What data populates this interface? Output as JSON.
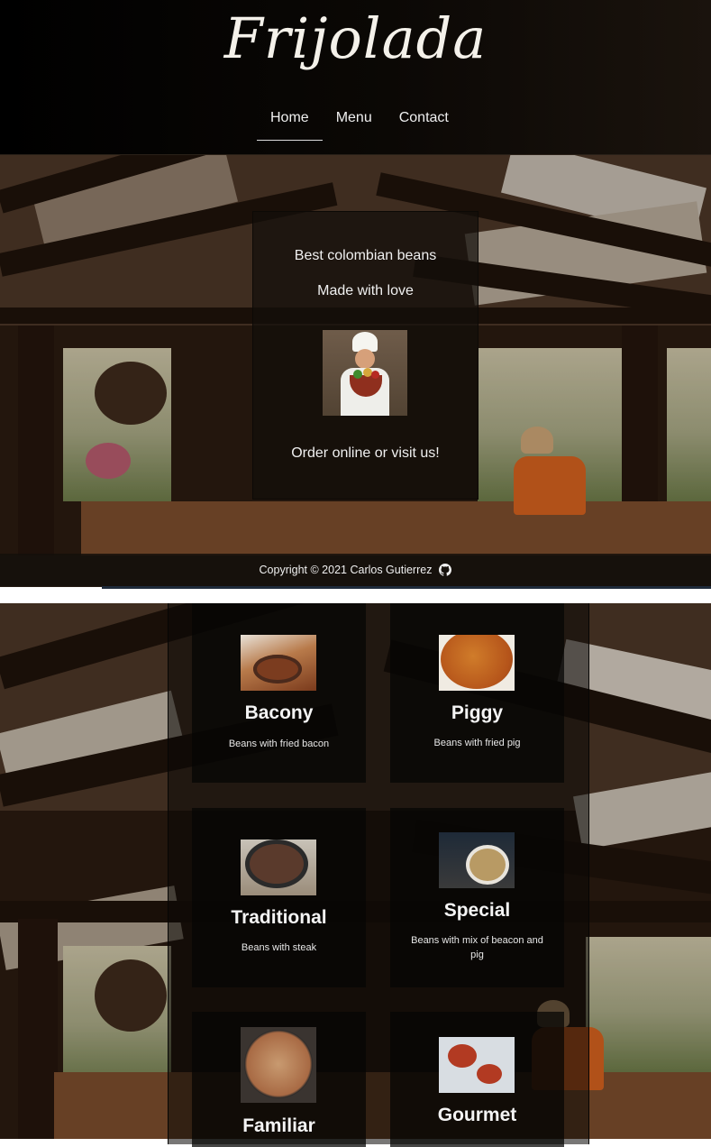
{
  "header": {
    "brand": "Frijolada",
    "nav": [
      {
        "label": "Home",
        "active": true
      },
      {
        "label": "Menu",
        "active": false
      },
      {
        "label": "Contact",
        "active": false
      }
    ]
  },
  "hero": {
    "line1": "Best colombian beans",
    "line2": "Made with love",
    "line3": "Order online or visit us!",
    "image_icon": "chef-icon"
  },
  "footer": {
    "copyright": "Copyright © 2021 Carlos Gutierrez",
    "icon": "github-icon"
  },
  "menu": {
    "items": [
      {
        "title": "Bacony",
        "desc": "Beans with fried bacon"
      },
      {
        "title": "Piggy",
        "desc": "Beans with fried pig"
      },
      {
        "title": "Traditional",
        "desc": "Beans with steak"
      },
      {
        "title": "Special",
        "desc": "Beans with mix of beacon and pig"
      },
      {
        "title": "Familiar",
        "desc": ""
      },
      {
        "title": "Gourmet",
        "desc": ""
      }
    ]
  },
  "colors": {
    "header_bg": "#000000",
    "card_bg": "#060504",
    "text": "#f2f2f2"
  }
}
